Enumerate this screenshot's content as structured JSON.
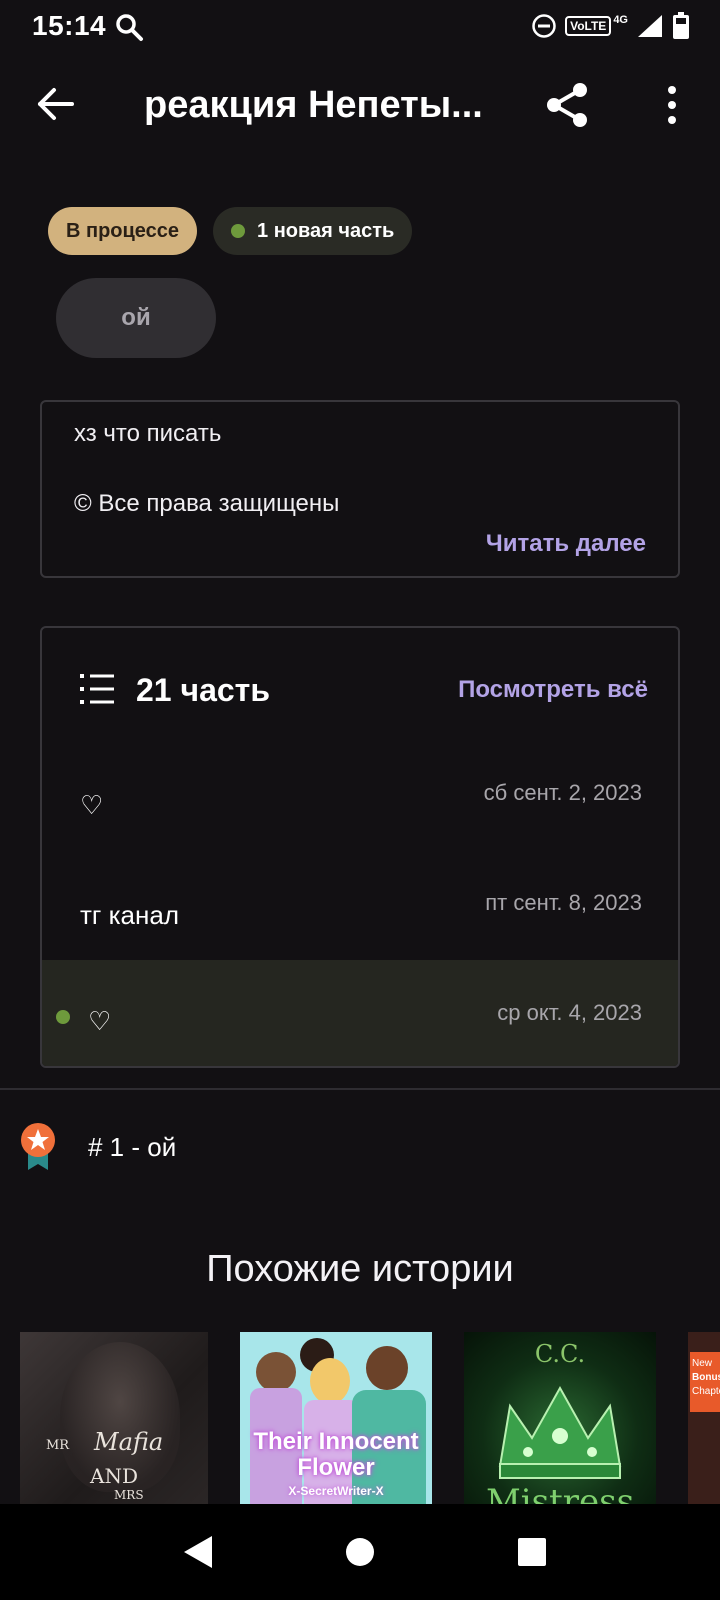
{
  "status_bar": {
    "time": "15:14",
    "volte": "VoLTE",
    "network": "4G"
  },
  "app_bar": {
    "title": "реакция Непеты..."
  },
  "badges": {
    "status": "В процессе",
    "new_parts": "1 новая часть"
  },
  "tag": "ой",
  "description": {
    "line1": "хз что писать",
    "line2": "© Все права защищены",
    "read_more": "Читать далее"
  },
  "parts": {
    "count_label": "21 часть",
    "see_all": "Посмотреть всё",
    "items": [
      {
        "title": "♡",
        "date": "сб сент. 2, 2023"
      },
      {
        "title": "тг канал",
        "date": "пт сент. 8, 2023"
      },
      {
        "title": "♡",
        "date": "ср окт. 4, 2023",
        "is_new": true
      }
    ]
  },
  "ranking": {
    "text": "# 1 - ой"
  },
  "similar": {
    "title": "Похожие истории",
    "covers": [
      {
        "line1": "MR",
        "line2": "Mafia",
        "line3": "AND",
        "line4": "MRS"
      },
      {
        "line1": "Their Innocent",
        "line2": "Flower",
        "line3": "X-SecretWriter-X"
      },
      {
        "line1": "C.C.",
        "line2": "Mistress"
      },
      {
        "line1": "New",
        "line2": "Bonus",
        "line3": "Chapter"
      }
    ]
  },
  "colors": {
    "background": "#121013",
    "accent": "#b3a3e6",
    "status_pill": "#d2b27e",
    "new_dot": "#6e9a3c"
  }
}
